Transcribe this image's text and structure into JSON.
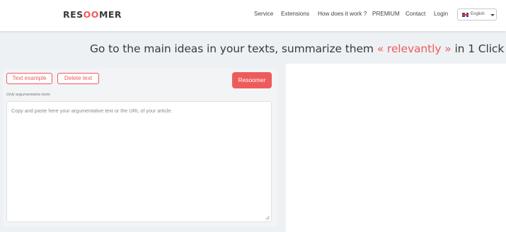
{
  "brand": {
    "prefix": "RES",
    "middle": "OO",
    "suffix": "MER"
  },
  "nav": {
    "items": [
      "Service",
      "Extensions",
      "How does it work ?",
      "PREMIUM",
      "Contact",
      "Login"
    ],
    "language": "English"
  },
  "headline": {
    "before": "Go to the main ideas in your texts, summarize them",
    "accent": "« relevantly »",
    "after": "in 1 Click"
  },
  "tool": {
    "text_example_label": "Text example",
    "delete_text_label": "Delete text",
    "submit_label": "Resoomer",
    "hint": "Only argumentative texts",
    "textarea_placeholder": "Copy and paste here your argumentative text or the URL of your article."
  },
  "colors": {
    "accent": "#ef5b5b",
    "band": "#eef1f4",
    "text": "#3a3a3a"
  }
}
